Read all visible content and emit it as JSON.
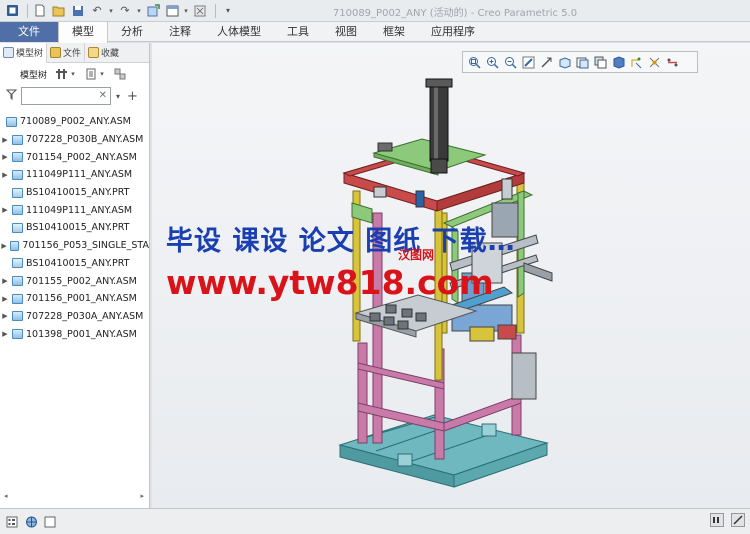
{
  "window": {
    "title": "710089_P002_ANY (活动的) - Creo Parametric 5.0"
  },
  "quick_access": {
    "icons": [
      "app-icon",
      "new-icon",
      "open-icon",
      "save-icon",
      "undo-icon",
      "redo-icon",
      "regenerate-icon",
      "windows-icon",
      "close-window-icon",
      "customize-icon"
    ]
  },
  "ribbon": {
    "tabs": [
      {
        "label": "文件"
      },
      {
        "label": "模型"
      },
      {
        "label": "分析"
      },
      {
        "label": "注释"
      },
      {
        "label": "人体模型"
      },
      {
        "label": "工具"
      },
      {
        "label": "视图"
      },
      {
        "label": "框架"
      },
      {
        "label": "应用程序"
      }
    ],
    "active_tab": "模型"
  },
  "panel": {
    "tabs": [
      {
        "label": "模型树"
      },
      {
        "label": "文件"
      },
      {
        "label": "收藏"
      }
    ],
    "toolbar_label": "模型树",
    "filter_placeholder": ""
  },
  "tree": {
    "items": [
      {
        "label": "710089_P002_ANY.ASM",
        "type": "asm",
        "expandable": false
      },
      {
        "label": "707228_P030B_ANY.ASM",
        "type": "asm",
        "expandable": true
      },
      {
        "label": "701154_P002_ANY.ASM",
        "type": "asm",
        "expandable": true
      },
      {
        "label": "111049P111_ANY.ASM",
        "type": "asm",
        "expandable": true
      },
      {
        "label": "BS10410015_ANY.PRT",
        "type": "prt",
        "expandable": false
      },
      {
        "label": "111049P111_ANY.ASM",
        "type": "asm",
        "expandable": true
      },
      {
        "label": "BS10410015_ANY.PRT",
        "type": "prt",
        "expandable": false
      },
      {
        "label": "701156_P053_SINGLE_STA",
        "type": "asm",
        "expandable": true
      },
      {
        "label": "BS10410015_ANY.PRT",
        "type": "prt",
        "expandable": false
      },
      {
        "label": "701155_P002_ANY.ASM",
        "type": "asm",
        "expandable": true
      },
      {
        "label": "701156_P001_ANY.ASM",
        "type": "asm",
        "expandable": true
      },
      {
        "label": "707228_P030A_ANY.ASM",
        "type": "asm",
        "expandable": true
      },
      {
        "label": "101398_P001_ANY.ASM",
        "type": "asm",
        "expandable": true
      }
    ]
  },
  "graphics": {
    "view_toolbar_icons": [
      "refit-icon",
      "zoom-in-icon",
      "zoom-out-icon",
      "repaint-icon",
      "spin-center-icon",
      "saved-views-icon",
      "view-manager-icon",
      "display-style-icon",
      "perspective-icon",
      "datum-display-icon",
      "annotation-display-icon",
      "section-icon"
    ],
    "watermark_line1": "毕设 课设 论文 图纸 下载…",
    "watermark_line2": "www.ytw818.com",
    "watermark_small": "汉图网"
  },
  "colors": {
    "file_tab": "#4f6fa6",
    "frame_pink": "#c97aa8",
    "frame_red": "#c94a4a",
    "frame_green": "#8dc97a",
    "frame_cyan": "#6fb8bf",
    "frame_yellow": "#d8c43a"
  }
}
